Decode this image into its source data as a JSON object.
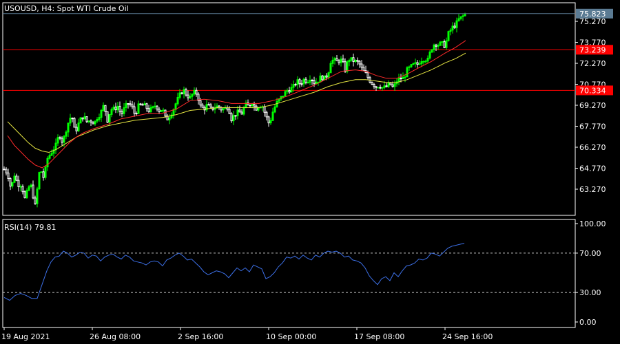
{
  "header": {
    "symbol_text": "USOUSD, H4:  Spot WTI Crude Oil"
  },
  "colors": {
    "background": "#000000",
    "frame": "#ffffff",
    "bull_candle": "#00ff00",
    "bear_candle": "#ffffff",
    "ma_fast": "#ff2a2a",
    "ma_slow": "#e6e642",
    "hline": "#ff0000",
    "rsi_line": "#3c6fe6",
    "price_badge_bg": "#5b7b93",
    "hline_badge_bg": "#ff0000"
  },
  "chart_data": [
    {
      "type": "candlestick",
      "title": "USOUSD, H4:  Spot WTI Crude Oil",
      "timeframe": "H4",
      "ylim": [
        61.4,
        76.6
      ],
      "y_ticks": [
        "75.270",
        "73.770",
        "72.270",
        "70.770",
        "69.270",
        "67.770",
        "66.270",
        "64.770",
        "63.270"
      ],
      "x_ticks": [
        "19 Aug 2021",
        "26 Aug 08:00",
        "2 Sep 16:00",
        "10 Sep 00:00",
        "17 Sep 08:00",
        "24 Sep 16:00"
      ],
      "current_price": "75.823",
      "horizontal_lines": [
        {
          "value": 73.239,
          "label": "73.239"
        },
        {
          "value": 70.334,
          "label": "70.334"
        }
      ],
      "close_path": [
        [
          0,
          64.7
        ],
        [
          5,
          64.4
        ],
        [
          10,
          63.3
        ],
        [
          15,
          64.3
        ],
        [
          20,
          63.6
        ],
        [
          25,
          63.6
        ],
        [
          30,
          62.6
        ],
        [
          38,
          63.7
        ],
        [
          45,
          62.1
        ],
        [
          52,
          64.8
        ],
        [
          58,
          64.0
        ],
        [
          62,
          65.4
        ],
        [
          70,
          66.0
        ],
        [
          75,
          66.4
        ],
        [
          80,
          67.2
        ],
        [
          85,
          66.6
        ],
        [
          92,
          67.9
        ],
        [
          98,
          68.6
        ],
        [
          103,
          67.3
        ],
        [
          110,
          68.2
        ],
        [
          115,
          68.5
        ],
        [
          120,
          68.1
        ],
        [
          125,
          68.2
        ],
        [
          131,
          68.0
        ],
        [
          135,
          68.4
        ],
        [
          140,
          68.7
        ],
        [
          145,
          69.3
        ],
        [
          150,
          68.2
        ],
        [
          155,
          69.0
        ],
        [
          160,
          69.0
        ],
        [
          165,
          69.2
        ],
        [
          170,
          68.6
        ],
        [
          175,
          69.1
        ],
        [
          180,
          69.4
        ],
        [
          185,
          69.2
        ],
        [
          190,
          68.6
        ],
        [
          195,
          69.2
        ],
        [
          200,
          69.3
        ],
        [
          205,
          69.2
        ],
        [
          210,
          68.9
        ],
        [
          215,
          69.0
        ],
        [
          220,
          69.3
        ],
        [
          225,
          68.9
        ],
        [
          230,
          69.0
        ],
        [
          235,
          68.2
        ],
        [
          240,
          68.5
        ],
        [
          245,
          68.9
        ],
        [
          250,
          69.5
        ],
        [
          255,
          70.0
        ],
        [
          260,
          70.4
        ],
        [
          265,
          70.0
        ],
        [
          270,
          69.8
        ],
        [
          275,
          70.2
        ],
        [
          280,
          70.1
        ],
        [
          285,
          69.2
        ],
        [
          290,
          69.0
        ],
        [
          295,
          69.3
        ],
        [
          300,
          69.0
        ],
        [
          305,
          69.1
        ],
        [
          310,
          69.2
        ],
        [
          315,
          69.0
        ],
        [
          320,
          69.0
        ],
        [
          325,
          69.2
        ],
        [
          330,
          68.3
        ],
        [
          335,
          68.6
        ],
        [
          340,
          68.8
        ],
        [
          345,
          68.7
        ],
        [
          350,
          69.3
        ],
        [
          355,
          69.2
        ],
        [
          360,
          69.5
        ],
        [
          365,
          69.0
        ],
        [
          370,
          69.3
        ],
        [
          375,
          69.2
        ],
        [
          380,
          68.5
        ],
        [
          385,
          67.9
        ],
        [
          390,
          68.8
        ],
        [
          395,
          69.4
        ],
        [
          400,
          69.7
        ],
        [
          405,
          70.0
        ],
        [
          410,
          70.3
        ],
        [
          415,
          70.4
        ],
        [
          420,
          70.6
        ],
        [
          425,
          71.0
        ],
        [
          430,
          70.8
        ],
        [
          435,
          71.1
        ],
        [
          440,
          71.0
        ],
        [
          445,
          71.3
        ],
        [
          450,
          70.9
        ],
        [
          455,
          71.0
        ],
        [
          460,
          71.3
        ],
        [
          465,
          71.2
        ],
        [
          470,
          71.5
        ],
        [
          474,
          72.4
        ],
        [
          478,
          72.5
        ],
        [
          483,
          72.4
        ],
        [
          490,
          72.5
        ],
        [
          495,
          71.8
        ],
        [
          500,
          72.6
        ],
        [
          505,
          72.5
        ],
        [
          510,
          72.4
        ],
        [
          515,
          72.3
        ],
        [
          520,
          71.8
        ],
        [
          525,
          71.5
        ],
        [
          530,
          71.1
        ],
        [
          535,
          70.8
        ],
        [
          540,
          70.6
        ],
        [
          545,
          70.7
        ],
        [
          550,
          70.5
        ],
        [
          555,
          70.6
        ],
        [
          560,
          70.8
        ],
        [
          565,
          70.5
        ],
        [
          570,
          71.0
        ],
        [
          575,
          71.2
        ],
        [
          580,
          71.2
        ],
        [
          585,
          71.8
        ],
        [
          590,
          72.0
        ],
        [
          595,
          72.2
        ],
        [
          600,
          72.2
        ],
        [
          605,
          72.5
        ],
        [
          610,
          72.6
        ],
        [
          615,
          72.5
        ],
        [
          620,
          73.3
        ],
        [
          625,
          73.7
        ],
        [
          630,
          73.6
        ],
        [
          635,
          73.7
        ],
        [
          640,
          73.5
        ],
        [
          645,
          74.4
        ],
        [
          650,
          74.8
        ],
        [
          655,
          75.0
        ],
        [
          660,
          75.4
        ],
        [
          665,
          75.6
        ],
        [
          670,
          75.8
        ]
      ],
      "ma_fast_path": [
        [
          5,
          67.1
        ],
        [
          15,
          66.4
        ],
        [
          25,
          65.9
        ],
        [
          35,
          65.4
        ],
        [
          45,
          65.0
        ],
        [
          55,
          64.8
        ],
        [
          65,
          65.1
        ],
        [
          75,
          65.6
        ],
        [
          85,
          66.1
        ],
        [
          95,
          66.6
        ],
        [
          105,
          67.0
        ],
        [
          115,
          67.3
        ],
        [
          130,
          67.6
        ],
        [
          150,
          67.9
        ],
        [
          170,
          68.3
        ],
        [
          190,
          68.5
        ],
        [
          210,
          68.7
        ],
        [
          230,
          68.7
        ],
        [
          250,
          69.0
        ],
        [
          270,
          69.6
        ],
        [
          290,
          69.7
        ],
        [
          310,
          69.6
        ],
        [
          330,
          69.4
        ],
        [
          350,
          69.4
        ],
        [
          370,
          69.4
        ],
        [
          390,
          69.6
        ],
        [
          410,
          69.9
        ],
        [
          430,
          70.3
        ],
        [
          450,
          70.7
        ],
        [
          470,
          71.2
        ],
        [
          490,
          71.7
        ],
        [
          510,
          71.8
        ],
        [
          525,
          71.7
        ],
        [
          540,
          71.4
        ],
        [
          555,
          71.2
        ],
        [
          570,
          71.2
        ],
        [
          585,
          71.5
        ],
        [
          600,
          71.9
        ],
        [
          620,
          72.4
        ],
        [
          640,
          73.0
        ],
        [
          655,
          73.4
        ],
        [
          670,
          73.9
        ]
      ],
      "ma_slow_path": [
        [
          5,
          68.1
        ],
        [
          15,
          67.6
        ],
        [
          25,
          67.1
        ],
        [
          35,
          66.6
        ],
        [
          45,
          66.2
        ],
        [
          55,
          66.0
        ],
        [
          65,
          65.9
        ],
        [
          75,
          66.1
        ],
        [
          85,
          66.4
        ],
        [
          95,
          66.7
        ],
        [
          105,
          67.0
        ],
        [
          115,
          67.2
        ],
        [
          130,
          67.5
        ],
        [
          150,
          67.8
        ],
        [
          170,
          68.0
        ],
        [
          190,
          68.2
        ],
        [
          210,
          68.3
        ],
        [
          230,
          68.4
        ],
        [
          250,
          68.6
        ],
        [
          270,
          68.9
        ],
        [
          290,
          69.0
        ],
        [
          310,
          69.1
        ],
        [
          330,
          69.1
        ],
        [
          350,
          69.1
        ],
        [
          370,
          69.1
        ],
        [
          390,
          69.3
        ],
        [
          410,
          69.6
        ],
        [
          430,
          69.9
        ],
        [
          450,
          70.2
        ],
        [
          470,
          70.6
        ],
        [
          490,
          70.9
        ],
        [
          510,
          71.1
        ],
        [
          525,
          71.1
        ],
        [
          540,
          71.0
        ],
        [
          555,
          70.9
        ],
        [
          570,
          70.9
        ],
        [
          585,
          71.1
        ],
        [
          600,
          71.4
        ],
        [
          620,
          71.8
        ],
        [
          640,
          72.3
        ],
        [
          655,
          72.6
        ],
        [
          670,
          73.0
        ]
      ]
    },
    {
      "type": "line",
      "title": "RSI(14) 79.81",
      "ylim": [
        0,
        100
      ],
      "y_ticks": [
        "100.00",
        "70.00",
        "30.00",
        "0.00"
      ],
      "levels": [
        70,
        30
      ],
      "points": [
        [
          0,
          25
        ],
        [
          8,
          22
        ],
        [
          16,
          27
        ],
        [
          24,
          29
        ],
        [
          32,
          27
        ],
        [
          40,
          24
        ],
        [
          48,
          24
        ],
        [
          56,
          40
        ],
        [
          62,
          52
        ],
        [
          68,
          61
        ],
        [
          74,
          66
        ],
        [
          80,
          67
        ],
        [
          86,
          72
        ],
        [
          92,
          70
        ],
        [
          98,
          66
        ],
        [
          104,
          68
        ],
        [
          110,
          71
        ],
        [
          116,
          70
        ],
        [
          122,
          65
        ],
        [
          128,
          68
        ],
        [
          134,
          67
        ],
        [
          140,
          62
        ],
        [
          146,
          66
        ],
        [
          152,
          68
        ],
        [
          158,
          69
        ],
        [
          164,
          66
        ],
        [
          170,
          64
        ],
        [
          176,
          68
        ],
        [
          182,
          66
        ],
        [
          188,
          62
        ],
        [
          194,
          61
        ],
        [
          200,
          60
        ],
        [
          206,
          58
        ],
        [
          212,
          61
        ],
        [
          218,
          62
        ],
        [
          224,
          61
        ],
        [
          230,
          57
        ],
        [
          236,
          63
        ],
        [
          242,
          65
        ],
        [
          248,
          68
        ],
        [
          254,
          70
        ],
        [
          260,
          67
        ],
        [
          266,
          63
        ],
        [
          272,
          64
        ],
        [
          278,
          60
        ],
        [
          284,
          56
        ],
        [
          290,
          51
        ],
        [
          296,
          48
        ],
        [
          302,
          50
        ],
        [
          308,
          52
        ],
        [
          314,
          51
        ],
        [
          320,
          49
        ],
        [
          326,
          45
        ],
        [
          332,
          50
        ],
        [
          338,
          55
        ],
        [
          344,
          52
        ],
        [
          350,
          55
        ],
        [
          356,
          51
        ],
        [
          362,
          58
        ],
        [
          368,
          56
        ],
        [
          374,
          54
        ],
        [
          380,
          44
        ],
        [
          386,
          46
        ],
        [
          392,
          50
        ],
        [
          398,
          56
        ],
        [
          404,
          60
        ],
        [
          410,
          66
        ],
        [
          416,
          65
        ],
        [
          422,
          67
        ],
        [
          428,
          64
        ],
        [
          434,
          68
        ],
        [
          440,
          65
        ],
        [
          446,
          63
        ],
        [
          452,
          68
        ],
        [
          458,
          66
        ],
        [
          464,
          70
        ],
        [
          470,
          72
        ],
        [
          476,
          71
        ],
        [
          482,
          72
        ],
        [
          488,
          70
        ],
        [
          494,
          66
        ],
        [
          500,
          67
        ],
        [
          506,
          63
        ],
        [
          512,
          62
        ],
        [
          518,
          60
        ],
        [
          524,
          55
        ],
        [
          530,
          47
        ],
        [
          536,
          42
        ],
        [
          542,
          38
        ],
        [
          548,
          44
        ],
        [
          554,
          46
        ],
        [
          560,
          42
        ],
        [
          566,
          50
        ],
        [
          572,
          46
        ],
        [
          578,
          52
        ],
        [
          584,
          57
        ],
        [
          590,
          58
        ],
        [
          596,
          60
        ],
        [
          602,
          64
        ],
        [
          608,
          63
        ],
        [
          614,
          65
        ],
        [
          620,
          70
        ],
        [
          626,
          69
        ],
        [
          632,
          67
        ],
        [
          638,
          71
        ],
        [
          644,
          75
        ],
        [
          650,
          77
        ],
        [
          656,
          78
        ],
        [
          662,
          79
        ],
        [
          668,
          80
        ]
      ]
    }
  ]
}
